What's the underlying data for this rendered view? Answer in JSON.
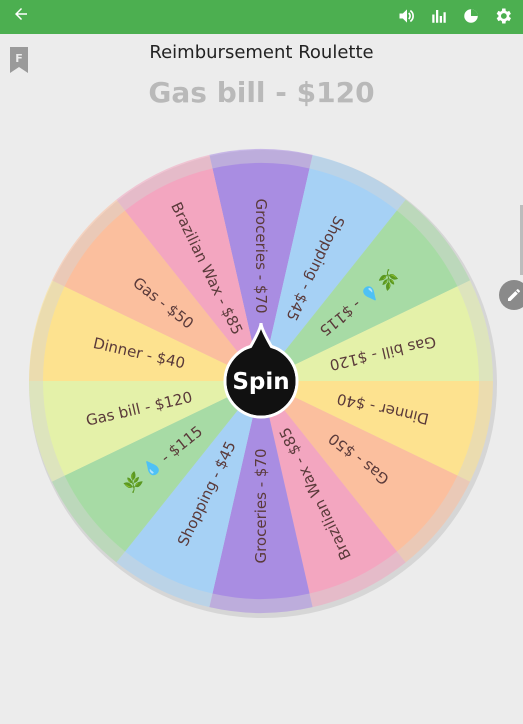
{
  "app": {
    "title": "Reimbursement Roulette",
    "result": "Gas bill - $120",
    "spin_label": "Spin"
  },
  "appbar": {
    "back_icon": "arrow-left-icon",
    "actions": [
      "volume-icon",
      "bar-chart-icon",
      "pie-chart-icon",
      "gear-icon"
    ]
  },
  "wheel": {
    "segments": [
      {
        "label": "Groceries - $70",
        "color": "#a98de2"
      },
      {
        "label": "Shopping - $45",
        "color": "#a6d1f5"
      },
      {
        "label": "🌿 💧 - $115",
        "color": "#a7dba5"
      },
      {
        "label": "Gas bill - $120",
        "color": "#e4f1a9"
      },
      {
        "label": "Dinner - $40",
        "color": "#fde28f"
      },
      {
        "label": "Gas - $50",
        "color": "#fbbf9e"
      },
      {
        "label": "Brazilian Wax - $85",
        "color": "#f3a6c0"
      },
      {
        "label": "Groceries - $70",
        "color": "#a98de2"
      },
      {
        "label": "Shopping - $45",
        "color": "#a6d1f5"
      },
      {
        "label": "🌿 💧 - $115",
        "color": "#a7dba5"
      },
      {
        "label": "Gas bill - $120",
        "color": "#e4f1a9"
      },
      {
        "label": "Dinner - $40",
        "color": "#fde28f"
      },
      {
        "label": "Gas - $50",
        "color": "#fbbf9e"
      },
      {
        "label": "Brazilian Wax - $85",
        "color": "#f3a6c0"
      }
    ],
    "text_color": "#5a3a3a",
    "hub_color": "#111111"
  },
  "colors": {
    "appbar": "#4caf50",
    "background": "#ececec",
    "result_text": "#b9b9b9"
  }
}
